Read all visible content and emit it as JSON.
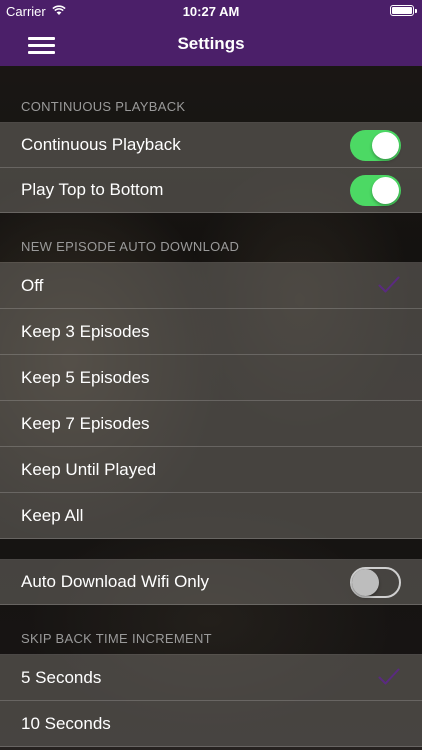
{
  "status_bar": {
    "carrier": "Carrier",
    "time": "10:27 AM"
  },
  "nav": {
    "title": "Settings",
    "menu_icon": "hamburger-menu-icon"
  },
  "colors": {
    "nav_bg": "#4b1f69",
    "toggle_on": "#4cd964",
    "checkmark": "#5a2a80"
  },
  "sections": {
    "continuous": {
      "header": "CONTINUOUS PLAYBACK",
      "rows": [
        {
          "label": "Continuous Playback",
          "toggle": true
        },
        {
          "label": "Play Top to Bottom",
          "toggle": true
        }
      ]
    },
    "auto_download": {
      "header": "NEW EPISODE AUTO DOWNLOAD",
      "selected": "Off",
      "rows": [
        {
          "label": "Off",
          "checked": true
        },
        {
          "label": "Keep 3 Episodes",
          "checked": false
        },
        {
          "label": "Keep 5 Episodes",
          "checked": false
        },
        {
          "label": "Keep 7 Episodes",
          "checked": false
        },
        {
          "label": "Keep Until Played",
          "checked": false
        },
        {
          "label": "Keep All",
          "checked": false
        }
      ]
    },
    "wifi": {
      "rows": [
        {
          "label": "Auto Download Wifi Only",
          "toggle": false
        }
      ]
    },
    "skip_back": {
      "header": "SKIP BACK TIME INCREMENT",
      "selected": "5 Seconds",
      "rows": [
        {
          "label": "5 Seconds",
          "checked": true
        },
        {
          "label": "10 Seconds",
          "checked": false
        }
      ]
    }
  }
}
